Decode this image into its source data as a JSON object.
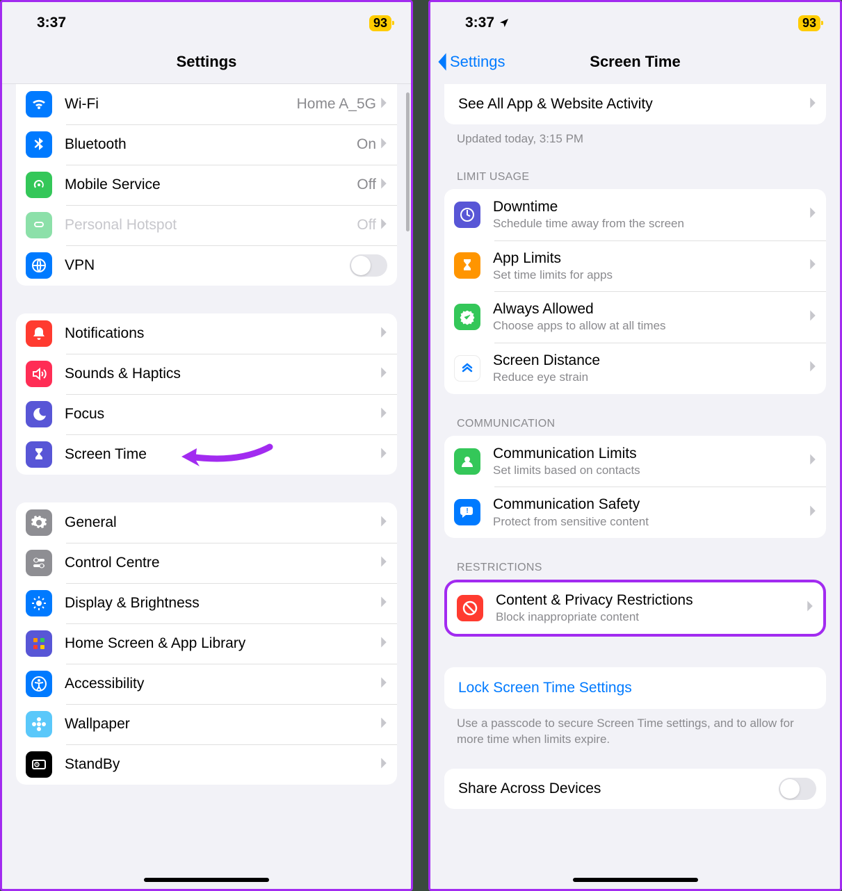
{
  "status": {
    "time": "3:37",
    "battery": "93"
  },
  "left": {
    "title": "Settings",
    "rows": {
      "wifi": {
        "label": "Wi-Fi",
        "value": "Home A_5G"
      },
      "bt": {
        "label": "Bluetooth",
        "value": "On"
      },
      "mobile": {
        "label": "Mobile Service",
        "value": "Off"
      },
      "hotspot": {
        "label": "Personal Hotspot",
        "value": "Off"
      },
      "vpn": {
        "label": "VPN"
      },
      "notif": {
        "label": "Notifications"
      },
      "sounds": {
        "label": "Sounds & Haptics"
      },
      "focus": {
        "label": "Focus"
      },
      "st": {
        "label": "Screen Time"
      },
      "general": {
        "label": "General"
      },
      "cc": {
        "label": "Control Centre"
      },
      "display": {
        "label": "Display & Brightness"
      },
      "home": {
        "label": "Home Screen & App Library"
      },
      "access": {
        "label": "Accessibility"
      },
      "wall": {
        "label": "Wallpaper"
      },
      "standby": {
        "label": "StandBy"
      }
    }
  },
  "right": {
    "back": "Settings",
    "title": "Screen Time",
    "activity_row": "See All App & Website Activity",
    "updated_footer": "Updated today, 3:15 PM",
    "headers": {
      "limit": "LIMIT USAGE",
      "comm": "COMMUNICATION",
      "restr": "RESTRICTIONS"
    },
    "limit": {
      "downtime": {
        "t": "Downtime",
        "s": "Schedule time away from the screen"
      },
      "applimits": {
        "t": "App Limits",
        "s": "Set time limits for apps"
      },
      "always": {
        "t": "Always Allowed",
        "s": "Choose apps to allow at all times"
      },
      "distance": {
        "t": "Screen Distance",
        "s": "Reduce eye strain"
      }
    },
    "comm": {
      "limits": {
        "t": "Communication Limits",
        "s": "Set limits based on contacts"
      },
      "safety": {
        "t": "Communication Safety",
        "s": "Protect from sensitive content"
      }
    },
    "restr": {
      "content": {
        "t": "Content & Privacy Restrictions",
        "s": "Block inappropriate content"
      }
    },
    "lock_link": "Lock Screen Time Settings",
    "lock_footer": "Use a passcode to secure Screen Time settings, and to allow for more time when limits expire.",
    "share_label": "Share Across Devices"
  }
}
